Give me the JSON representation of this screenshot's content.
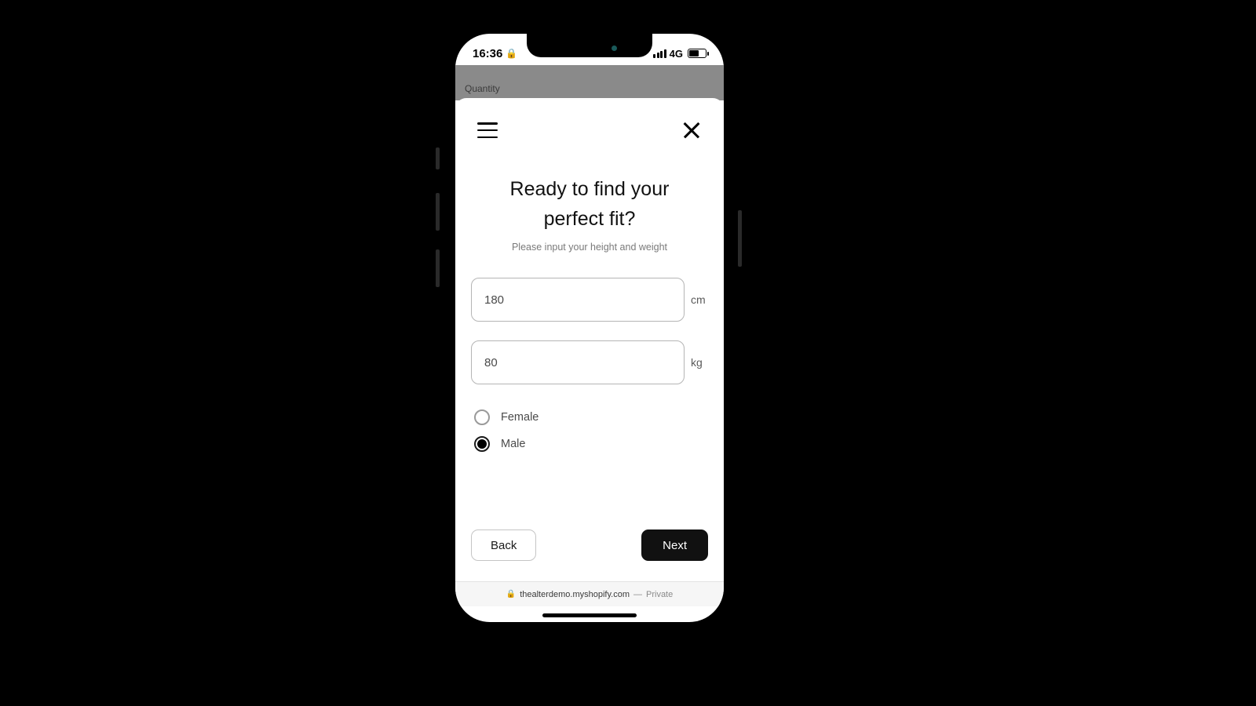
{
  "status": {
    "time": "16:36",
    "network": "4G"
  },
  "background": {
    "quantity_label": "Quantity"
  },
  "modal": {
    "title_line1": "Ready to find your",
    "title_line2": "perfect fit?",
    "subtitle": "Please input your height and weight",
    "height": {
      "value": "180",
      "unit": "cm"
    },
    "weight": {
      "value": "80",
      "unit": "kg"
    },
    "gender": {
      "options": [
        {
          "label": "Female",
          "selected": false
        },
        {
          "label": "Male",
          "selected": true
        }
      ]
    },
    "back_label": "Back",
    "next_label": "Next"
  },
  "browser": {
    "domain": "thealterdemo.myshopify.com",
    "separator": "—",
    "mode": "Private"
  }
}
